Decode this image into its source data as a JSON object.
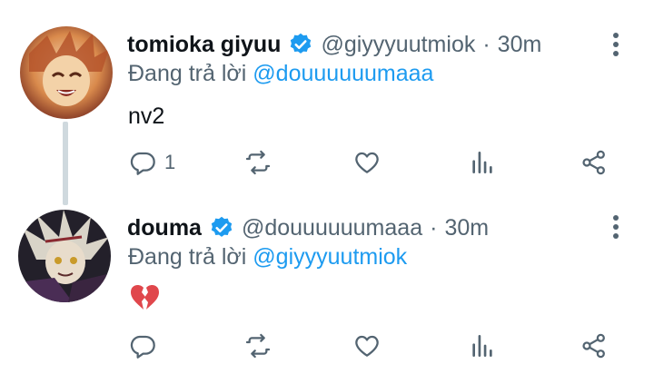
{
  "tweets": [
    {
      "display_name": "tomioka giyuu",
      "handle": "@giyyyuutmiok",
      "separator": "·",
      "time": "30m",
      "reply_prefix": "Đang trả lời",
      "reply_to": "@douuuuuumaaa",
      "content": "nv2",
      "reply_count": "1",
      "avatar_colors": [
        "#c96a3a",
        "#f0c89a",
        "#7a2f20"
      ]
    },
    {
      "display_name": "douma",
      "handle": "@douuuuuumaaa",
      "separator": "·",
      "time": "30m",
      "reply_prefix": "Đang trả lời",
      "reply_to": "@giyyyuutmiok",
      "content_emoji": "broken-heart",
      "reply_count": "",
      "avatar_colors": [
        "#2a2530",
        "#d9d4c8",
        "#5a3a5a"
      ]
    }
  ],
  "colors": {
    "text": "#0f1419",
    "muted": "#536471",
    "accent": "#1d9bf0",
    "thread_line": "#cfd9de",
    "broken_heart": "#e0474c"
  },
  "icons": [
    "verified-badge-icon",
    "more-vertical-icon",
    "reply-icon",
    "retweet-icon",
    "like-icon",
    "analytics-icon",
    "share-icon"
  ]
}
